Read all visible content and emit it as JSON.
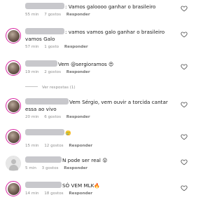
{
  "comments": [
    {
      "text": ": Vamos galoooo ganhar o brasileiro",
      "time": "55 min",
      "likes": "7 gostos",
      "reply": "Responder"
    },
    {
      "text": ": vamos vamos galo ganhar o brasileiro vamos Galo",
      "time": "57 min",
      "likes": "1 gosto",
      "reply": "Responder"
    },
    {
      "mention": "Vem @sergioramos",
      "emoji": "😍",
      "time": "19 min",
      "likes": "2 gostos",
      "reply": "Responder",
      "view_replies": "Ver respostas (1)"
    },
    {
      "text": "Vem Sérgio, vem ouvir a torcida cantar essa ao vivo",
      "time": "20 min",
      "likes": "6 gostos",
      "reply": "Responder"
    },
    {
      "emoji": "🥲",
      "time": "15 min",
      "likes": "12 gostos",
      "reply": "Responder"
    },
    {
      "text": "N pode ser real",
      "emoji": "😲",
      "time": "5 min",
      "likes": "3 gostos",
      "reply": "Responder"
    },
    {
      "text": "SÓ VEM MLK",
      "emoji": "🔥",
      "time": "14 min",
      "likes": "18 gostos",
      "reply": "Responder"
    }
  ],
  "icons": {
    "like": "heart-icon"
  },
  "colors": {
    "text": "#1c1c1c",
    "meta": "#8e8e8e",
    "avatar_ring": "#d6249f"
  }
}
